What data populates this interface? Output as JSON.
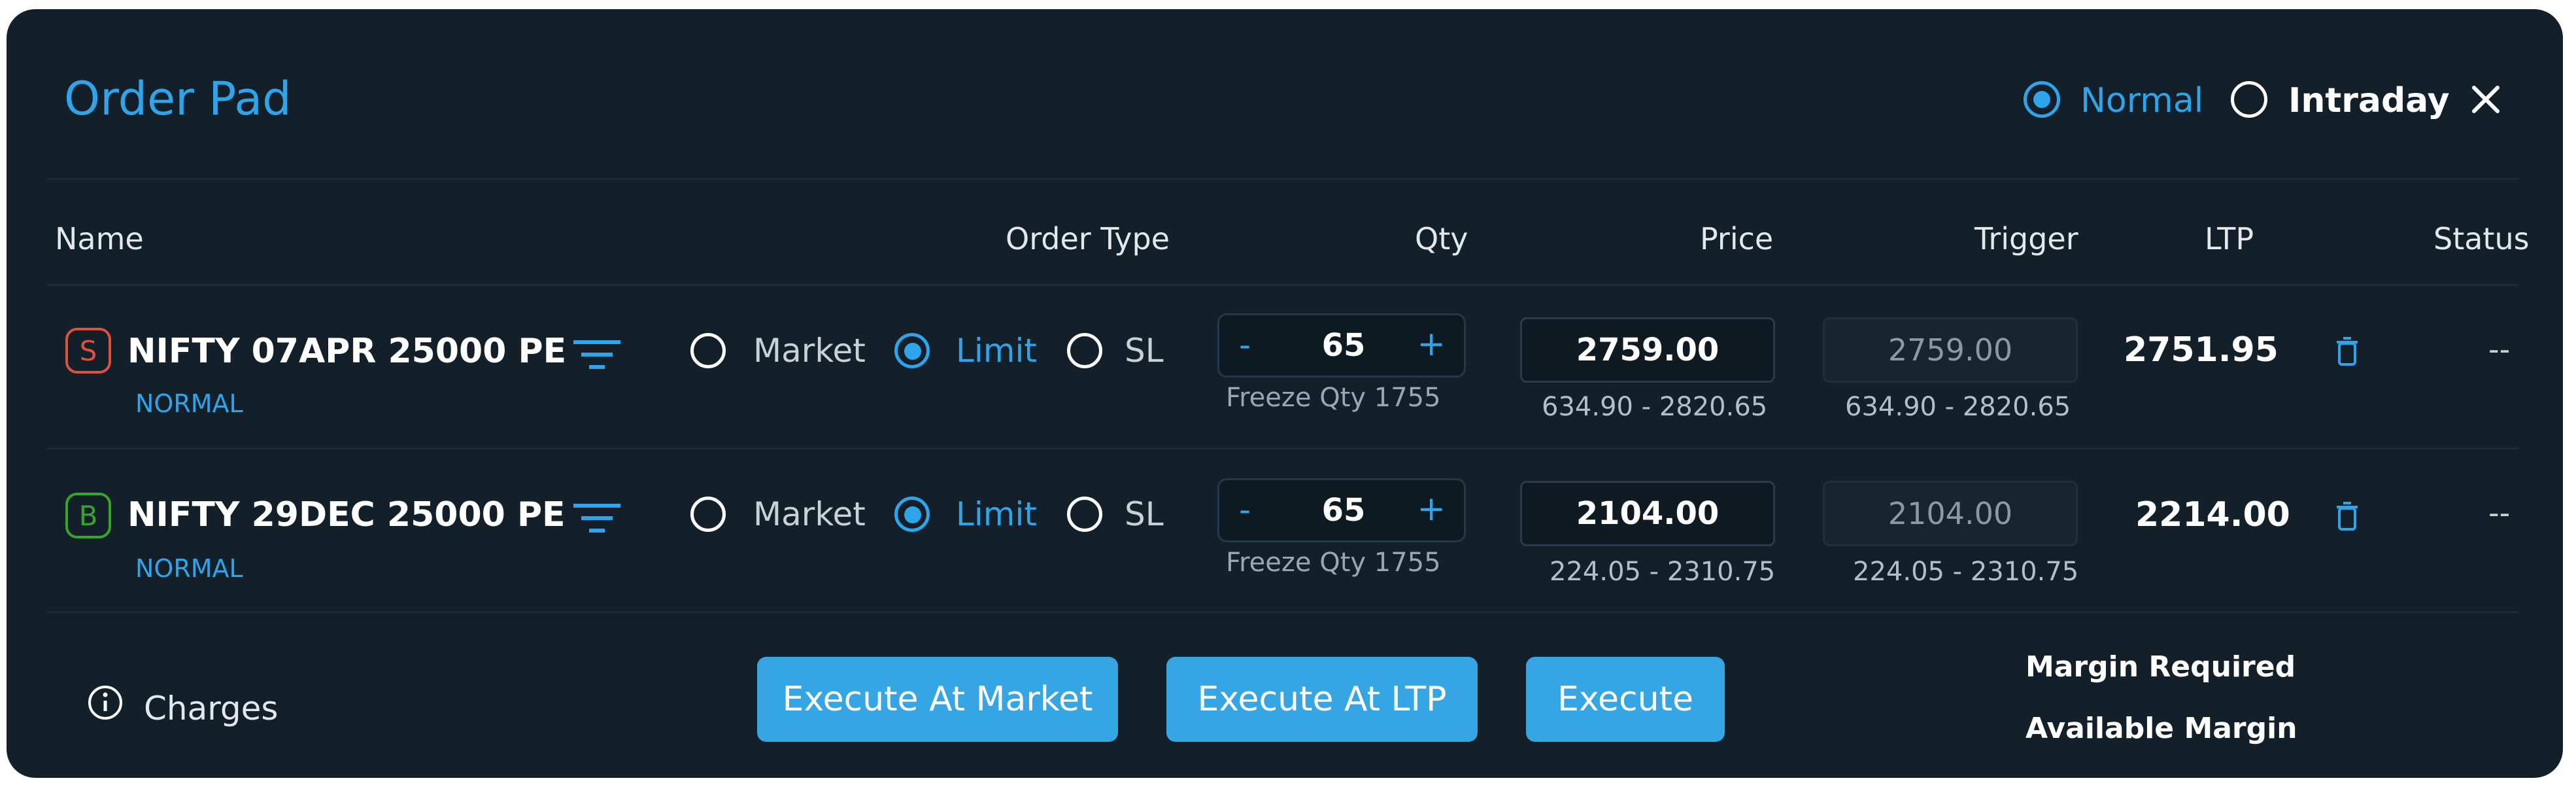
{
  "title": "Order Pad",
  "product_toggle": {
    "options": [
      {
        "label": "Normal",
        "selected": true
      },
      {
        "label": "Intraday",
        "selected": false
      }
    ]
  },
  "table": {
    "headers": {
      "name": "Name",
      "order_type": "Order Type",
      "qty": "Qty",
      "price": "Price",
      "trigger": "Trigger",
      "ltp": "LTP",
      "status": "Status"
    }
  },
  "rows": [
    {
      "side": "S",
      "side_color": "#e0503c",
      "symbol": "NIFTY 07APR 25000 PE",
      "product": "NORMAL",
      "order_types": [
        "Market",
        "Limit",
        "SL"
      ],
      "selected_order_type": "Limit",
      "qty_minus": "-",
      "qty": "65",
      "qty_plus": "+",
      "freeze_qty": "Freeze Qty 1755",
      "price": "2759.00",
      "price_range": "634.90 - 2820.65",
      "trigger": "2759.00",
      "trigger_range": "634.90 - 2820.65",
      "ltp": "2751.95",
      "status": "--"
    },
    {
      "side": "B",
      "side_color": "#37a52b",
      "symbol": "NIFTY 29DEC 25000 PE",
      "product": "NORMAL",
      "order_types": [
        "Market",
        "Limit",
        "SL"
      ],
      "selected_order_type": "Limit",
      "qty_minus": "-",
      "qty": "65",
      "qty_plus": "+",
      "freeze_qty": "Freeze Qty 1755",
      "price": "2104.00",
      "price_range": "224.05 - 2310.75",
      "trigger": "2104.00",
      "trigger_range": "224.05 - 2310.75",
      "ltp": "2214.00",
      "status": "--"
    }
  ],
  "footer": {
    "charges_label": "Charges",
    "buttons": {
      "execute_at_market": "Execute At Market",
      "execute_at_ltp": "Execute At LTP",
      "execute": "Execute"
    },
    "margin_required_label": "Margin Required",
    "available_margin_label": "Available Margin"
  },
  "colors": {
    "accent": "#2ea5ea",
    "panel_bg": "#132029",
    "button_bg": "#35a6e3"
  },
  "icons": {
    "close": "close-icon",
    "filter": "filter-icon",
    "trash": "trash-icon",
    "info": "info-icon"
  }
}
